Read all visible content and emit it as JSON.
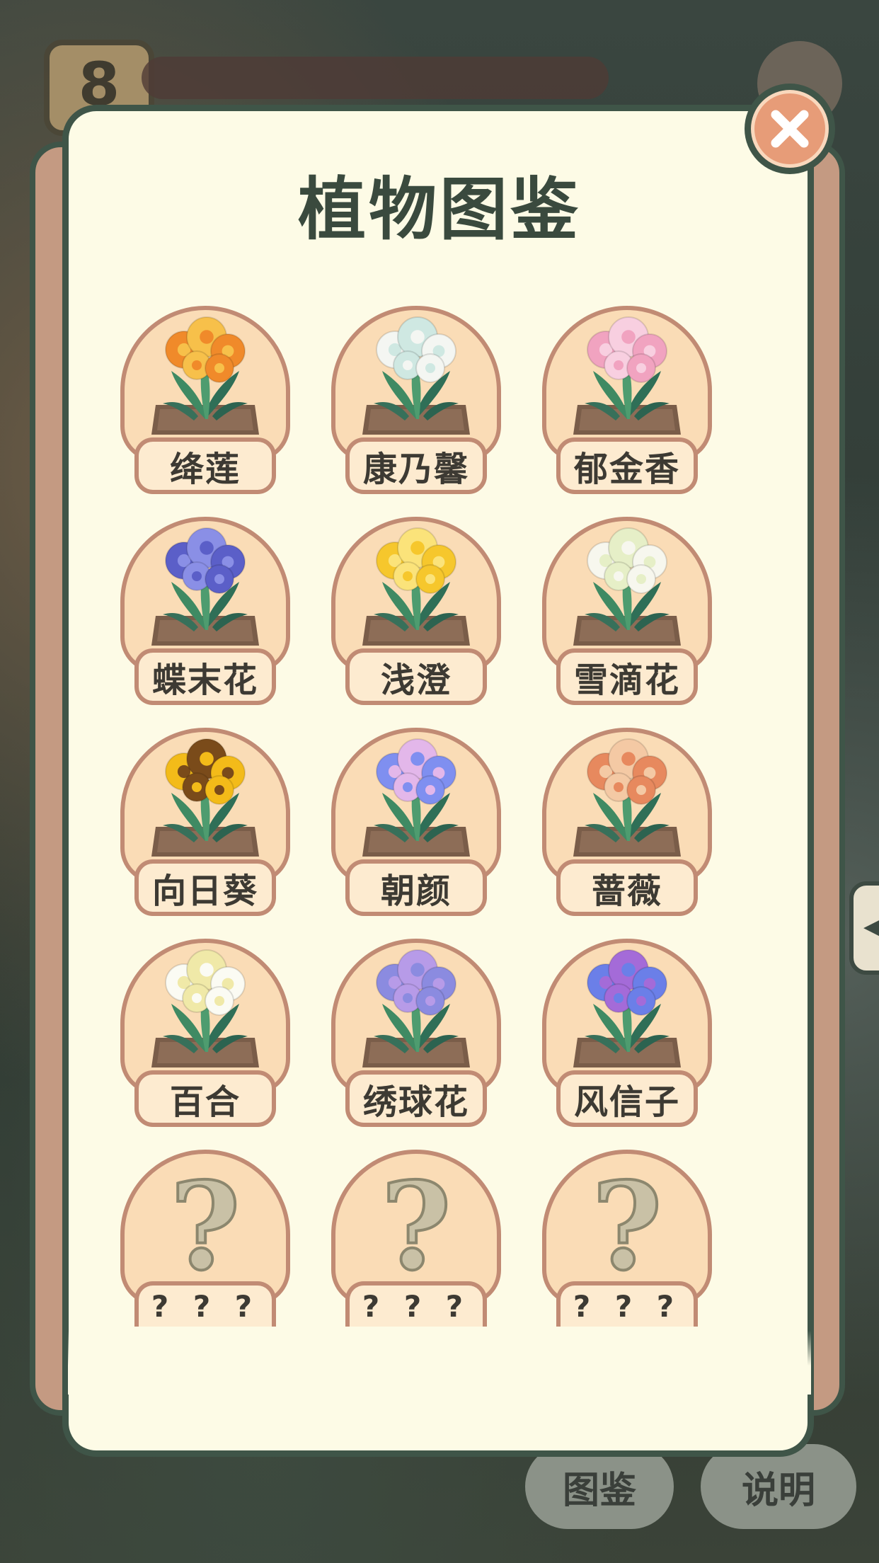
{
  "background": {
    "level_number": "8",
    "buttons": {
      "catalog": "图鉴",
      "help": "说明"
    }
  },
  "dialog": {
    "title": "植物图鉴",
    "close_label": "close"
  },
  "plants": [
    {
      "name": "绛莲",
      "icon": "orange-flower",
      "color": "#f08a2a",
      "color2": "#f7c04a"
    },
    {
      "name": "康乃馨",
      "icon": "white-flower",
      "color": "#f4f6f2",
      "color2": "#cfe8e2"
    },
    {
      "name": "郁金香",
      "icon": "pink-tulip",
      "color": "#f1a3c0",
      "color2": "#f8cfe0"
    },
    {
      "name": "蝶末花",
      "icon": "iris",
      "color": "#5b5fc8",
      "color2": "#8a8fe6"
    },
    {
      "name": "浅澄",
      "icon": "yellow-flower",
      "color": "#f6c72c",
      "color2": "#fbe37a"
    },
    {
      "name": "雪滴花",
      "icon": "snowdrop",
      "color": "#f7f7ee",
      "color2": "#e6efc7"
    },
    {
      "name": "向日葵",
      "icon": "sunflower",
      "color": "#f3bb19",
      "color2": "#7a4b1a"
    },
    {
      "name": "朝颜",
      "icon": "morning-glory",
      "color": "#7f8ff0",
      "color2": "#e3b7ea"
    },
    {
      "name": "蔷薇",
      "icon": "rose",
      "color": "#e7895e",
      "color2": "#f4c9a4"
    },
    {
      "name": "百合",
      "icon": "lily",
      "color": "#fbfbf3",
      "color2": "#f0e9a8"
    },
    {
      "name": "绣球花",
      "icon": "hydrangea",
      "color": "#8b8be0",
      "color2": "#b79be8"
    },
    {
      "name": "风信子",
      "icon": "hyacinth",
      "color": "#6b7fe8",
      "color2": "#a46bd8"
    },
    {
      "name": "? ? ?",
      "icon": "question-mark",
      "locked": true
    },
    {
      "name": "? ? ?",
      "icon": "question-mark",
      "locked": true
    },
    {
      "name": "? ? ?",
      "icon": "question-mark",
      "locked": true
    }
  ]
}
